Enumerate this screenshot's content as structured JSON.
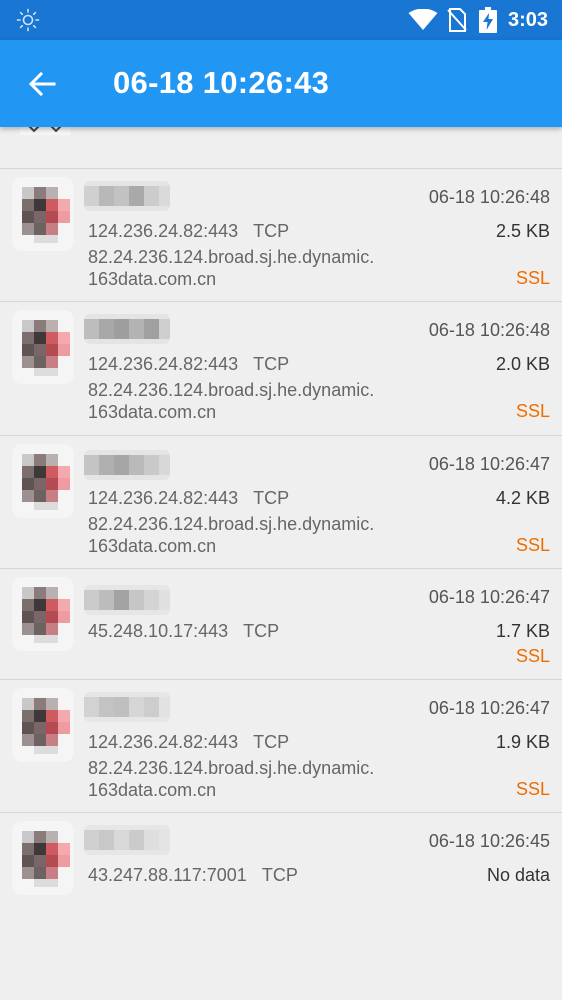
{
  "status_bar": {
    "time": "3:03",
    "icons": [
      "brightness-icon",
      "wifi-icon",
      "no-sim-icon",
      "battery-charging-icon"
    ]
  },
  "app_bar": {
    "title": "06-18 10:26:43",
    "back_icon": "arrow-back-icon"
  },
  "connections": [
    {
      "time": "06-18 10:26:48",
      "address": "124.236.24.82:443",
      "protocol": "TCP",
      "host_line1": "82.24.236.124.broad.sj.he.dynamic.",
      "host_line2": "163data.com.cn",
      "size": "2.5 KB",
      "tag": "SSL"
    },
    {
      "time": "06-18 10:26:48",
      "address": "124.236.24.82:443",
      "protocol": "TCP",
      "host_line1": "82.24.236.124.broad.sj.he.dynamic.",
      "host_line2": "163data.com.cn",
      "size": "2.0 KB",
      "tag": "SSL"
    },
    {
      "time": "06-18 10:26:47",
      "address": "124.236.24.82:443",
      "protocol": "TCP",
      "host_line1": "82.24.236.124.broad.sj.he.dynamic.",
      "host_line2": "163data.com.cn",
      "size": "4.2 KB",
      "tag": "SSL"
    },
    {
      "time": "06-18 10:26:47",
      "address": "45.248.10.17:443",
      "protocol": "TCP",
      "size": "1.7 KB",
      "tag": "SSL"
    },
    {
      "time": "06-18 10:26:47",
      "address": "124.236.24.82:443",
      "protocol": "TCP",
      "host_line1": "82.24.236.124.broad.sj.he.dynamic.",
      "host_line2": "163data.com.cn",
      "size": "1.9 KB",
      "tag": "SSL"
    },
    {
      "time": "06-18 10:26:45",
      "address": "43.247.88.117:7001",
      "protocol": "TCP",
      "size": "No data"
    }
  ],
  "colors": {
    "status_bar": "#1976d2",
    "app_bar": "#2196f3",
    "ssl_tag": "#ef6c00",
    "background": "#efefef"
  }
}
